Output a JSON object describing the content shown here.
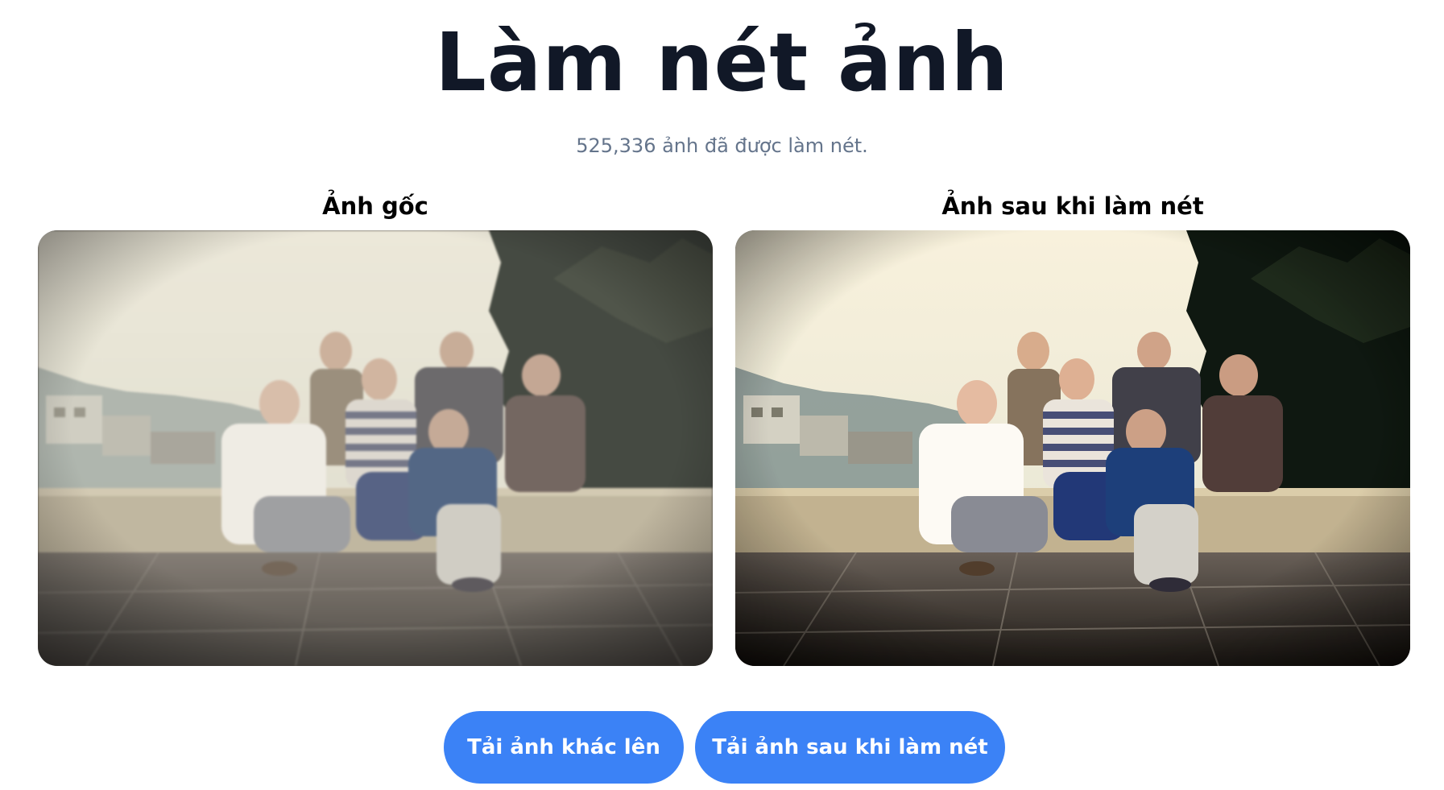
{
  "header": {
    "title": "Làm nét ảnh",
    "subtitle": "525,336 ảnh đã được làm nét."
  },
  "comparison": {
    "original_label": "Ảnh gốc",
    "enhanced_label": "Ảnh sau khi làm nét"
  },
  "actions": {
    "upload_label": "Tải ảnh khác lên",
    "download_label": "Tải ảnh sau khi làm nét"
  },
  "colors": {
    "accent": "#3b82f6",
    "title": "#111827",
    "subtitle": "#64748b"
  }
}
